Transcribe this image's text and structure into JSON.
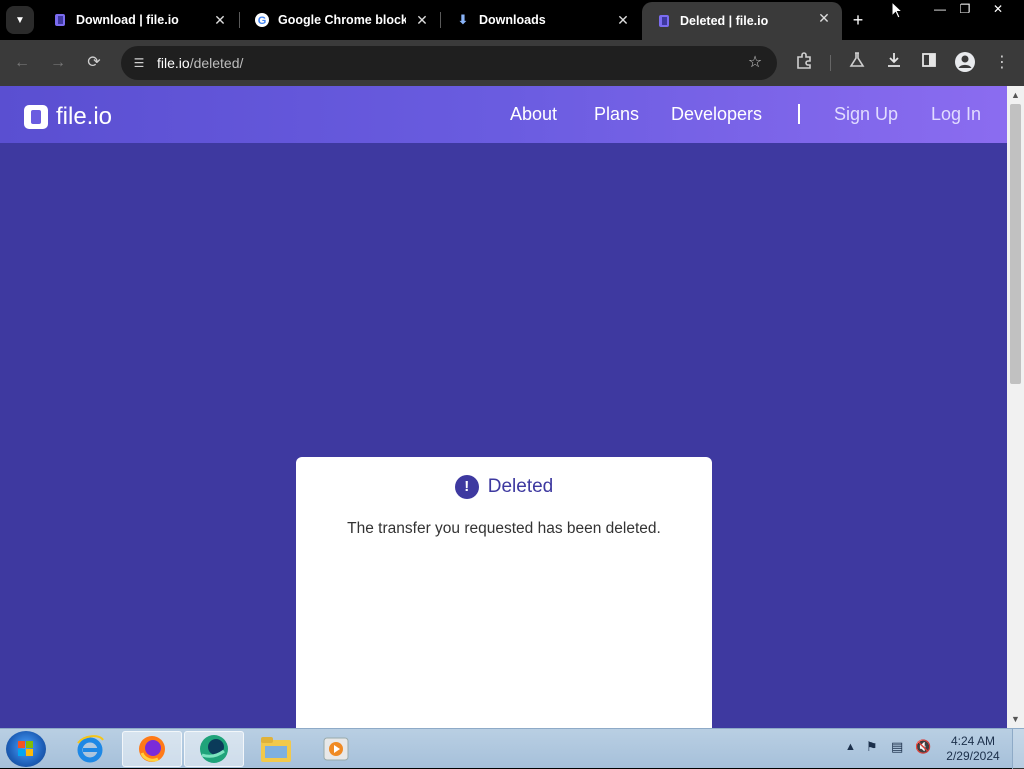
{
  "browser": {
    "tabs": [
      {
        "title": "Download | file.io",
        "active": false
      },
      {
        "title": "Google Chrome blocks",
        "active": false
      },
      {
        "title": "Downloads",
        "active": false
      },
      {
        "title": "Deleted | file.io",
        "active": true
      }
    ],
    "address": {
      "host": "file.io",
      "path": "/deleted/"
    }
  },
  "site": {
    "logo_text": "file.io",
    "nav": {
      "about": "About",
      "plans": "Plans",
      "developers": "Developers",
      "signup": "Sign Up",
      "login": "Log In"
    },
    "card": {
      "title": "Deleted",
      "alert_glyph": "!",
      "message": "The transfer you requested has been deleted."
    }
  },
  "taskbar": {
    "clock_time": "4:24 AM",
    "clock_date": "2/29/2024"
  },
  "colors": {
    "page_bg": "#3e39a0",
    "header_start": "#5a4fd1",
    "header_end": "#8b6cf0"
  }
}
